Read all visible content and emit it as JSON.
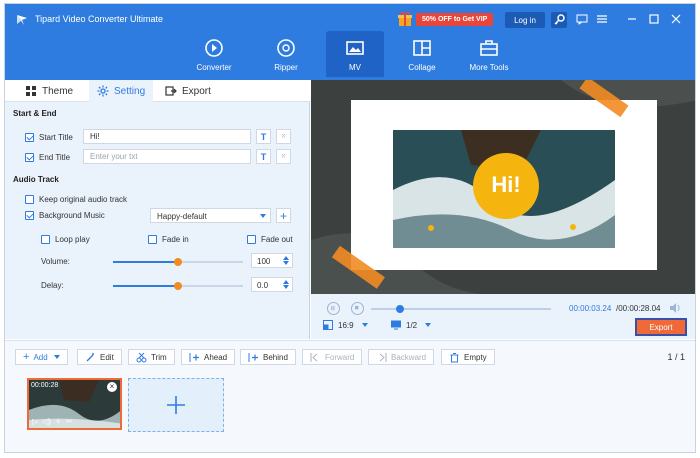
{
  "app": {
    "title": "Tipard Video Converter Ultimate"
  },
  "topbar": {
    "promo": "50% OFF to Get VIP",
    "login": "Log in"
  },
  "nav": [
    {
      "label": "Converter",
      "icon": "converter-icon"
    },
    {
      "label": "Ripper",
      "icon": "ripper-icon"
    },
    {
      "label": "MV",
      "icon": "mv-icon",
      "active": true
    },
    {
      "label": "Collage",
      "icon": "collage-icon"
    },
    {
      "label": "More Tools",
      "icon": "toolbox-icon"
    }
  ],
  "subtabs": {
    "theme": "Theme",
    "setting": "Setting",
    "export": "Export"
  },
  "start_end": {
    "header": "Start & End",
    "start_label": "Start Title",
    "start_value": "Hi!",
    "end_label": "End Title",
    "end_placeholder": "Enter your txt"
  },
  "audio": {
    "header": "Audio Track",
    "keep_label": "Keep original audio track",
    "bg_label": "Background Music",
    "bg_value": "Happy-default",
    "loop_label": "Loop play",
    "fadein_label": "Fade in",
    "fadeout_label": "Fade out",
    "volume_label": "Volume:",
    "volume_value": "100",
    "delay_label": "Delay:",
    "delay_value": "0.0"
  },
  "preview": {
    "title_text": "Hi!",
    "time_current": "00:00:03.24",
    "time_total": "/00:00:28.04",
    "ratio": "16:9",
    "page": "1/2",
    "export": "Export",
    "progress_fraction": 0.16
  },
  "toolbar": {
    "add": "Add",
    "edit": "Edit",
    "trim": "Trim",
    "ahead": "Ahead",
    "behind": "Behind",
    "forward": "Forward",
    "backward": "Backward",
    "empty": "Empty",
    "page": "1 / 1"
  },
  "clip": {
    "duration": "00:00:28"
  },
  "colors": {
    "accent": "#2f7ce0",
    "export": "#ef6a38",
    "highlight": "#f5b40e"
  }
}
